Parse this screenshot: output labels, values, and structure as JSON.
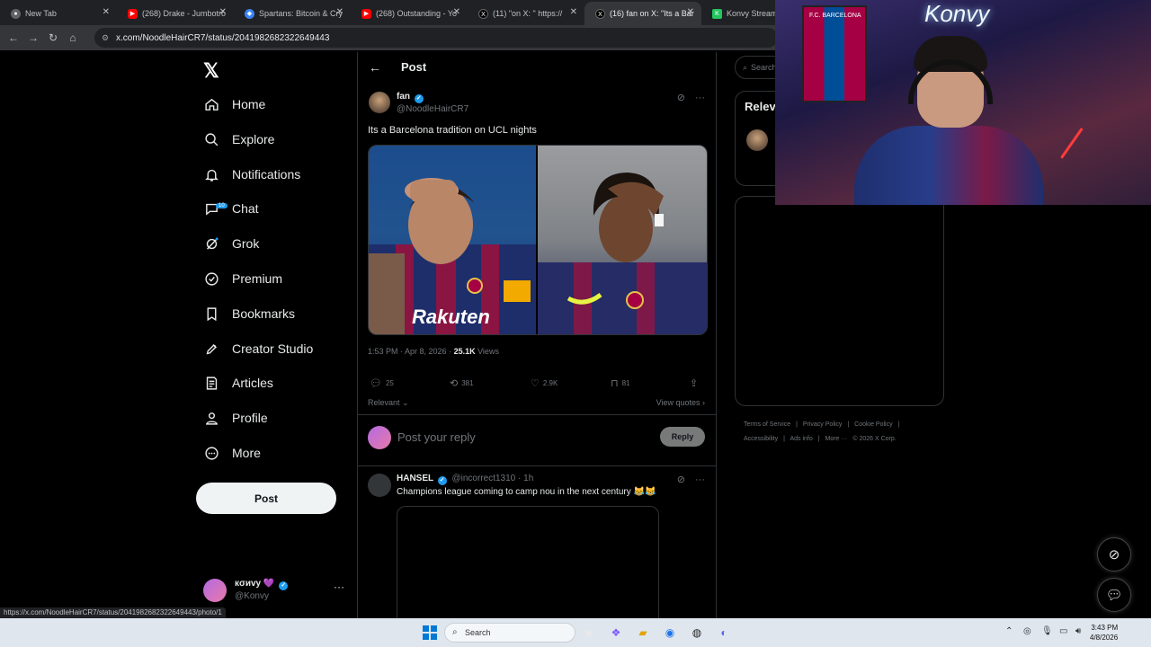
{
  "browser": {
    "tabs": [
      {
        "title": "New Tab",
        "icon": "chrome-icon"
      },
      {
        "title": "(268) Drake - Jumbotro",
        "icon": "youtube-icon"
      },
      {
        "title": "Spartans: Bitcoin & Cry",
        "icon": "web-icon"
      },
      {
        "title": "(268) Outstanding - Yo",
        "icon": "youtube-icon"
      },
      {
        "title": "(11) \"on X: \" https://",
        "icon": "x-icon"
      },
      {
        "title": "(16) fan on X: \"Its a Bar",
        "icon": "x-icon",
        "active": true
      },
      {
        "title": "Konvy Stream -",
        "icon": "kick-icon"
      }
    ],
    "url": "x.com/NoodleHairCR7/status/2041982682322649443",
    "status_url": "https://x.com/NoodleHairCR7/status/2041982682322649443/photo/1"
  },
  "nav": {
    "items": [
      {
        "label": "Home",
        "icon": "home-icon"
      },
      {
        "label": "Explore",
        "icon": "search-icon"
      },
      {
        "label": "Notifications",
        "icon": "bell-icon"
      },
      {
        "label": "Chat",
        "icon": "chat-icon",
        "badge": "10"
      },
      {
        "label": "Grok",
        "icon": "grok-icon"
      },
      {
        "label": "Premium",
        "icon": "premium-icon"
      },
      {
        "label": "Bookmarks",
        "icon": "bookmark-icon"
      },
      {
        "label": "Creator Studio",
        "icon": "rocket-icon"
      },
      {
        "label": "Articles",
        "icon": "article-icon"
      },
      {
        "label": "Profile",
        "icon": "person-icon"
      },
      {
        "label": "More",
        "icon": "more-circle-icon"
      }
    ],
    "post_label": "Post",
    "account": {
      "name": "кσиvу 💜",
      "handle": "@Konvy"
    }
  },
  "main": {
    "header_title": "Post",
    "post": {
      "author_name": "fan",
      "author_handle": "@NoodleHairCR7",
      "text": "Its a Barcelona tradition on UCL nights",
      "time": "1:53 PM · Apr 8, 2026 · ",
      "views_count": "25.1K",
      "views_label": " Views",
      "replies": "25",
      "reposts": "381",
      "likes": "2.9K",
      "bookmarks": "81",
      "sort_label": "Relevant ⌄",
      "view_quotes": "View quotes ›"
    },
    "reply": {
      "placeholder": "Post your reply",
      "button": "Reply"
    },
    "comment": {
      "name": "HANSEL",
      "handle": "@incorrect1310 · 1h",
      "text": "Champions league coming to camp nou in the next century 😹😹"
    }
  },
  "right": {
    "search_placeholder": "Search",
    "relevant_title": "Relev",
    "footer_row1": [
      "Terms of Service",
      "|",
      "Privacy Policy",
      "|",
      "Cookie Policy",
      "|"
    ],
    "footer_row2": [
      "Accessibility",
      "|",
      "Ads info",
      "|",
      "More ···",
      "© 2026 X Corp."
    ]
  },
  "webcam": {
    "logo": "Konvy",
    "jersey_text": "F.C. BARCELONA"
  },
  "taskbar": {
    "search_label": "Search",
    "time": "3:43 PM",
    "date": "4/8/2026"
  },
  "colors": {
    "accent": "#1d9bf0",
    "background": "#000000",
    "border": "#2f3336",
    "muted": "#71767b"
  }
}
